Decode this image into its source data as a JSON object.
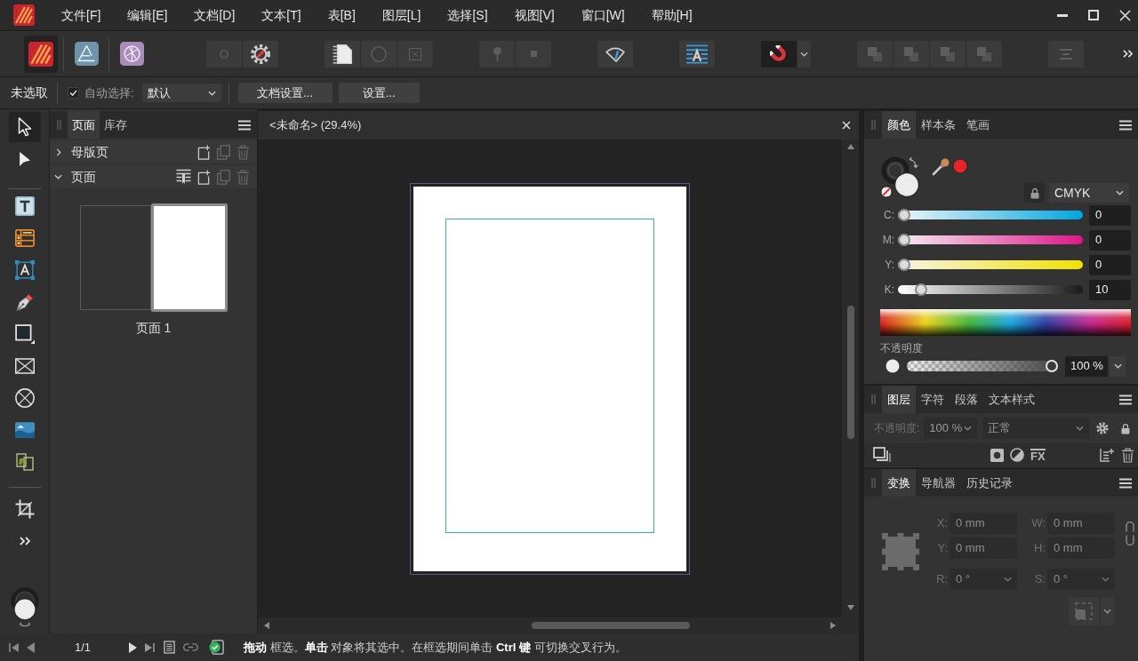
{
  "menu_bar": {
    "items": [
      "文件[F]",
      "编辑[E]",
      "文档[D]",
      "文本[T]",
      "表[B]",
      "图层[L]",
      "选择[S]",
      "视图[V]",
      "窗口[W]",
      "帮助[H]"
    ]
  },
  "toolbar": {
    "personas": [
      {
        "kind": "stripes",
        "selected": true
      },
      {
        "kind": "compass",
        "selected": false
      },
      {
        "kind": "aperture",
        "selected": false
      }
    ],
    "groups": [
      {
        "buttons": [
          {
            "kind": "dot",
            "disabled": true,
            "on": false
          },
          {
            "kind": "gear",
            "disabled": false,
            "on": false
          }
        ]
      },
      {
        "buttons": [
          {
            "kind": "page",
            "disabled": false,
            "on": false
          },
          {
            "kind": "ring",
            "disabled": true,
            "on": false
          },
          {
            "kind": "cross",
            "disabled": true,
            "on": false
          }
        ]
      },
      {
        "buttons": [
          {
            "kind": "pin",
            "disabled": true,
            "on": false
          },
          {
            "kind": "square",
            "disabled": true,
            "on": false
          }
        ]
      },
      {
        "buttons": [
          {
            "kind": "fan",
            "disabled": false,
            "on": false
          }
        ]
      },
      {
        "buttons": [
          {
            "kind": "textwrap",
            "disabled": false,
            "on": false
          }
        ]
      },
      {
        "buttons": [
          {
            "kind": "magnet",
            "disabled": false,
            "on": true
          }
        ]
      },
      {
        "buttons": [
          {
            "kind": "arrange",
            "disabled": true,
            "on": false
          },
          {
            "kind": "arrange",
            "disabled": true,
            "on": false
          },
          {
            "kind": "arrange",
            "disabled": true,
            "on": false
          },
          {
            "kind": "arrange",
            "disabled": true,
            "on": false
          }
        ]
      },
      {
        "buttons": [
          {
            "kind": "align",
            "disabled": true,
            "on": false
          }
        ]
      }
    ]
  },
  "context_bar": {
    "selection": "未选取",
    "auto_select": {
      "label": "自动选择:",
      "checked": true
    },
    "mode_dropdown": {
      "value": "默认"
    },
    "buttons": [
      "文档设置...",
      "设置..."
    ]
  },
  "tools": {
    "groups": [
      {
        "items": [
          {
            "kind": "move",
            "selected": true
          },
          {
            "kind": "node",
            "selected": false
          }
        ]
      },
      {
        "items": [
          {
            "kind": "frametext",
            "selected": false
          },
          {
            "kind": "table",
            "selected": false
          },
          {
            "kind": "arttext",
            "selected": false
          },
          {
            "kind": "pen",
            "selected": false
          },
          {
            "kind": "rectangle",
            "selected": false
          },
          {
            "kind": "pictureframe",
            "selected": false
          },
          {
            "kind": "ellipseframe",
            "selected": false
          },
          {
            "kind": "image",
            "selected": false
          },
          {
            "kind": "flow",
            "selected": false
          }
        ]
      },
      {
        "items": [
          {
            "kind": "crop",
            "selected": false
          },
          {
            "kind": "more",
            "selected": false
          }
        ]
      }
    ]
  },
  "pages_panel": {
    "tabs": [
      {
        "label": "页面",
        "selected": true
      },
      {
        "label": "库存",
        "selected": false
      }
    ],
    "sections": [
      {
        "label": "母版页",
        "expanded": false,
        "actions": [
          {
            "kind": "add",
            "disabled": false
          },
          {
            "kind": "copy",
            "disabled": true
          },
          {
            "kind": "delete",
            "disabled": true
          }
        ]
      },
      {
        "label": "页面",
        "expanded": true,
        "actions": [
          {
            "kind": "master",
            "disabled": false
          },
          {
            "kind": "add",
            "disabled": false
          },
          {
            "kind": "copy",
            "disabled": true
          },
          {
            "kind": "delete",
            "disabled": true
          }
        ],
        "pages": [
          {
            "label": "页面 1",
            "selected": true
          }
        ]
      }
    ]
  },
  "document": {
    "tab_title": "<未命名> (29.4%)"
  },
  "color_panel": {
    "tabs": [
      {
        "label": "颜色",
        "selected": true
      },
      {
        "label": "样本条",
        "selected": false
      },
      {
        "label": "笔画",
        "selected": false
      }
    ],
    "model": "CMYK",
    "channels": [
      {
        "kind": "cyan",
        "label": "C:",
        "level": 0,
        "value": "0"
      },
      {
        "kind": "magenta",
        "label": "M:",
        "level": 0,
        "value": "0"
      },
      {
        "kind": "yellow",
        "label": "Y:",
        "level": 0,
        "value": "0"
      },
      {
        "kind": "black",
        "label": "K:",
        "level": 0.1,
        "value": "10"
      }
    ],
    "opacity": {
      "label": "不透明度",
      "level": 1,
      "value": "100 %"
    }
  },
  "layers_panel": {
    "tabs": [
      {
        "label": "图层",
        "selected": true
      },
      {
        "label": "字符",
        "selected": false
      },
      {
        "label": "段落",
        "selected": false
      },
      {
        "label": "文本样式",
        "selected": false
      }
    ],
    "opacity": {
      "label": "不透明度:",
      "value": "100 %",
      "disabled": true
    },
    "blend_mode": {
      "value": "正常",
      "disabled": true
    },
    "effects": "FX"
  },
  "transform_panel": {
    "tabs": [
      {
        "label": "变换",
        "selected": true
      },
      {
        "label": "导航器",
        "selected": false
      },
      {
        "label": "历史记录",
        "selected": false
      }
    ],
    "fields": [
      {
        "kind": "field",
        "label": "X:",
        "value": "0 mm",
        "disabled": true
      },
      {
        "kind": "field",
        "label": "W:",
        "value": "0 mm",
        "disabled": true
      },
      {
        "kind": "field",
        "label": "Y:",
        "value": "0 mm",
        "disabled": true
      },
      {
        "kind": "field",
        "label": "H:",
        "value": "0 mm",
        "disabled": true
      },
      {
        "kind": "dropdown",
        "label": "R:",
        "value": "0 °",
        "disabled": true
      },
      {
        "kind": "dropdown",
        "label": "S:",
        "value": "0 °",
        "disabled": true
      }
    ]
  },
  "status_bar": {
    "page_counter": "1/1",
    "hint": "**拖动** 框选。**单击** 对象将其选中。在框选期间单击 **Ctrl 键** 可切换交叉行为。"
  }
}
